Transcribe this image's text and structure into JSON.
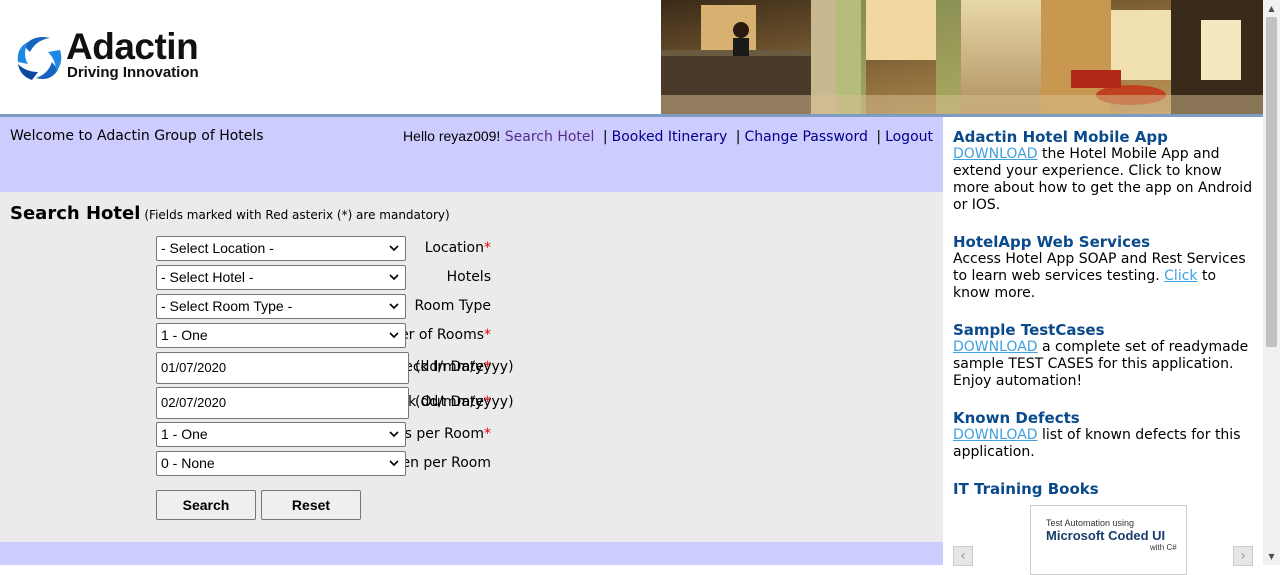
{
  "header": {
    "logo_name": "Adactin",
    "logo_tagline": "Driving Innovation"
  },
  "nav": {
    "welcome": "Welcome to Adactin Group of Hotels",
    "greeting": "Hello reyaz009!",
    "links": [
      "Search Hotel",
      "Booked Itinerary",
      "Change Password",
      "Logout"
    ],
    "separator": "|"
  },
  "form": {
    "title": "Search Hotel",
    "note": "(Fields marked with Red asterix (*) are mandatory)",
    "required_mark": "*",
    "fields": {
      "location": {
        "label": "Location",
        "value": "- Select Location -"
      },
      "hotels": {
        "label": "Hotels",
        "value": "- Select Hotel -"
      },
      "room_type": {
        "label": "Room Type",
        "value": "- Select Room Type -"
      },
      "num_rooms": {
        "label": "Number of Rooms",
        "value": "1 - One"
      },
      "check_in": {
        "label": "Check In Date",
        "value": "01/07/2020",
        "hint": "(dd/mm/yyyy)"
      },
      "check_out": {
        "label": "Check Out Date",
        "value": "02/07/2020",
        "hint": "(dd/mm/yyyy)"
      },
      "adults": {
        "label": "Adults per Room",
        "value": "1 - One"
      },
      "children": {
        "label": "Children per Room",
        "value": "0 - None"
      }
    },
    "search_label": "Search",
    "reset_label": "Reset"
  },
  "sidebar": {
    "mobile_app": {
      "title": "Adactin Hotel Mobile App",
      "link": "DOWNLOAD",
      "text": " the Hotel Mobile App and extend your experience. Click to know more about how to get the app on Android or IOS."
    },
    "web_services": {
      "title": "HotelApp Web Services",
      "text_before": "Access Hotel App SOAP and Rest Services to learn web services testing. ",
      "link": "Click",
      "text_after": " to know more."
    },
    "testcases": {
      "title": "Sample TestCases",
      "link": "DOWNLOAD",
      "text": " a complete set of readymade sample TEST CASES for this application. Enjoy automation!"
    },
    "defects": {
      "title": "Known Defects",
      "link": "DOWNLOAD",
      "text": " list of known defects for this application."
    },
    "books": {
      "title": "IT Training Books",
      "book_line1": "Test Automation using",
      "book_line2": "Microsoft Coded UI",
      "book_line3": "with C#"
    }
  },
  "colors": {
    "nav_band": "#ccccff",
    "form_bg": "#ebebeb",
    "link_dark": "#00008b",
    "link_visited": "#5a2b8a",
    "sidebar_heading": "#0a4a8a",
    "sidebar_link": "#3fa0e0",
    "required": "#e00000"
  }
}
